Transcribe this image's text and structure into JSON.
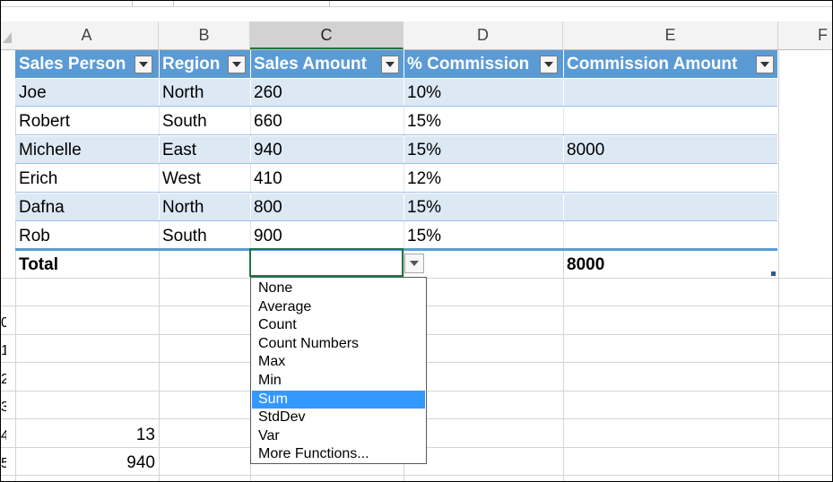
{
  "columns": [
    "A",
    "B",
    "C",
    "D",
    "E",
    "F"
  ],
  "table": {
    "headers": [
      "Sales Person",
      "Region",
      "Sales Amount",
      "% Commission",
      "Commission Amount"
    ],
    "rows": [
      [
        "Joe",
        "North",
        "260",
        "10%",
        ""
      ],
      [
        "Robert",
        "South",
        "660",
        "15%",
        ""
      ],
      [
        "Michelle",
        "East",
        "940",
        "15%",
        "8000"
      ],
      [
        "Erich",
        "West",
        "410",
        "12%",
        ""
      ],
      [
        "Dafna",
        "North",
        "800",
        "15%",
        ""
      ],
      [
        "Rob",
        "South",
        "900",
        "15%",
        ""
      ]
    ],
    "total": {
      "label": "Total",
      "commission_total": "8000"
    }
  },
  "dropdown": {
    "items": [
      "None",
      "Average",
      "Count",
      "Count Numbers",
      "Max",
      "Min",
      "Sum",
      "StdDev",
      "Var",
      "More Functions..."
    ],
    "selected": "Sum"
  },
  "lower_values": {
    "a14": "13",
    "a15": "940"
  },
  "row_number_fragments": [
    "0",
    "1",
    "2",
    "3",
    "4",
    "5"
  ],
  "colors": {
    "header_fill": "#5b9bd5",
    "band_fill": "#dde8f5",
    "selection_green": "#217346",
    "dropdown_highlight": "#3399ff"
  }
}
